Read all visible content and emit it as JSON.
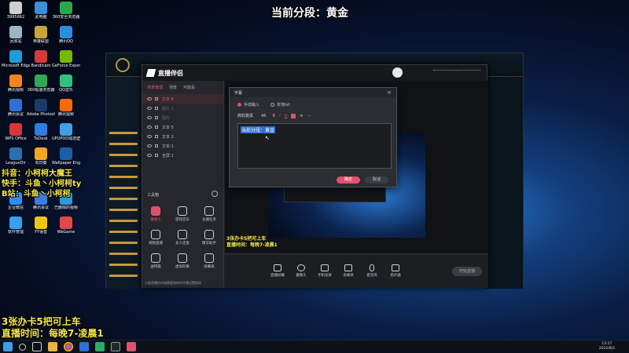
{
  "overlay": {
    "top_title": "当前分段：黄金",
    "left_lines": [
      "抖音：小柯柯大魔王",
      "快手：斗鱼丶小柯柯ty",
      "B站：斗鱼丶小柯柯"
    ],
    "bottom_lines": [
      "3张办卡5把可上车",
      "直播时间：每晚7-凌晨1"
    ],
    "preview_caption": [
      "3张办卡5把可上车",
      "直播时间：每晚7-凌晨1"
    ]
  },
  "desktop_icons": [
    {
      "label": "3995662",
      "color": "#cfcfcf"
    },
    {
      "label": "此电脑",
      "color": "#3a8fd8"
    },
    {
      "label": "360安全浏览器",
      "color": "#2aa84a"
    },
    {
      "label": "回收站",
      "color": "#9fb3c8"
    },
    {
      "label": "英雄联盟",
      "color": "#c8a43b"
    },
    {
      "label": "腾讯QQ",
      "color": "#2c8de0"
    },
    {
      "label": "Microsoft Edge",
      "color": "#1f9cd6"
    },
    {
      "label": "Bandicam",
      "color": "#d43a3a"
    },
    {
      "label": "GeForce Experience",
      "color": "#76b900"
    },
    {
      "label": "腾讯视频",
      "color": "#f58220"
    },
    {
      "label": "360极速浏览器",
      "color": "#32a852"
    },
    {
      "label": "QQ音乐",
      "color": "#31c27c"
    },
    {
      "label": "腾讯会议",
      "color": "#2f6fd6"
    },
    {
      "label": "Adobe Photoshop",
      "color": "#1a3a6b"
    },
    {
      "label": "腾讯视频",
      "color": "#ff6a00"
    },
    {
      "label": "WPS Office",
      "color": "#d73737"
    },
    {
      "label": "ToDesk",
      "color": "#2e7de1"
    },
    {
      "label": "UPUPOO动态壁纸",
      "color": "#3fa0e8"
    },
    {
      "label": "LeagueDir",
      "color": "#2a6fb0"
    },
    {
      "label": "向日葵",
      "color": "#f5a623"
    },
    {
      "label": "Wallpaper Engine",
      "color": "#1c5fa8"
    },
    {
      "label": "企业微信",
      "color": "#2f8cf0"
    },
    {
      "label": "腾讯会议",
      "color": "#3b7ee0"
    },
    {
      "label": "已删除的视频",
      "color": "#2a9ad6"
    },
    {
      "label": "软件管理",
      "color": "#35a0f0"
    },
    {
      "label": "YY语音",
      "color": "#f0c21f"
    },
    {
      "label": "WeGame",
      "color": "#e04848"
    }
  ],
  "app": {
    "logo": "直播伴侣",
    "tabs": [
      "场景管理",
      "场景",
      "可能是"
    ],
    "layers": [
      "文本 6",
      "图片 2",
      "图片",
      "文本 5",
      "文本 2",
      "文本 1",
      "全屏 1"
    ],
    "tools_header": "工具箱",
    "tools": [
      "摄像头",
      "游戏音乐",
      "主播任务",
      "视频直播",
      "多人连麦",
      "精华助手",
      "送特篇",
      "虚拟形象",
      "屏幕采",
      "公告",
      "更多"
    ],
    "status": "小窗直播的时候需要和你的开播设置相同",
    "toolbar": [
      "直播屏幕",
      "摄像头",
      "手机投屏",
      "多媒体",
      "麦克风",
      "扬声器"
    ],
    "start_button": "开始直播"
  },
  "dialog": {
    "title": "字幕",
    "radio_manual": "手动输入",
    "radio_file": "本地txt",
    "font_name": "微软雅黑",
    "font_size": "46",
    "content": "当前分段：黄金",
    "confirm": "确定",
    "cancel": "取消"
  },
  "taskbar": {
    "time": "13:57",
    "date": "2022/8/2"
  }
}
